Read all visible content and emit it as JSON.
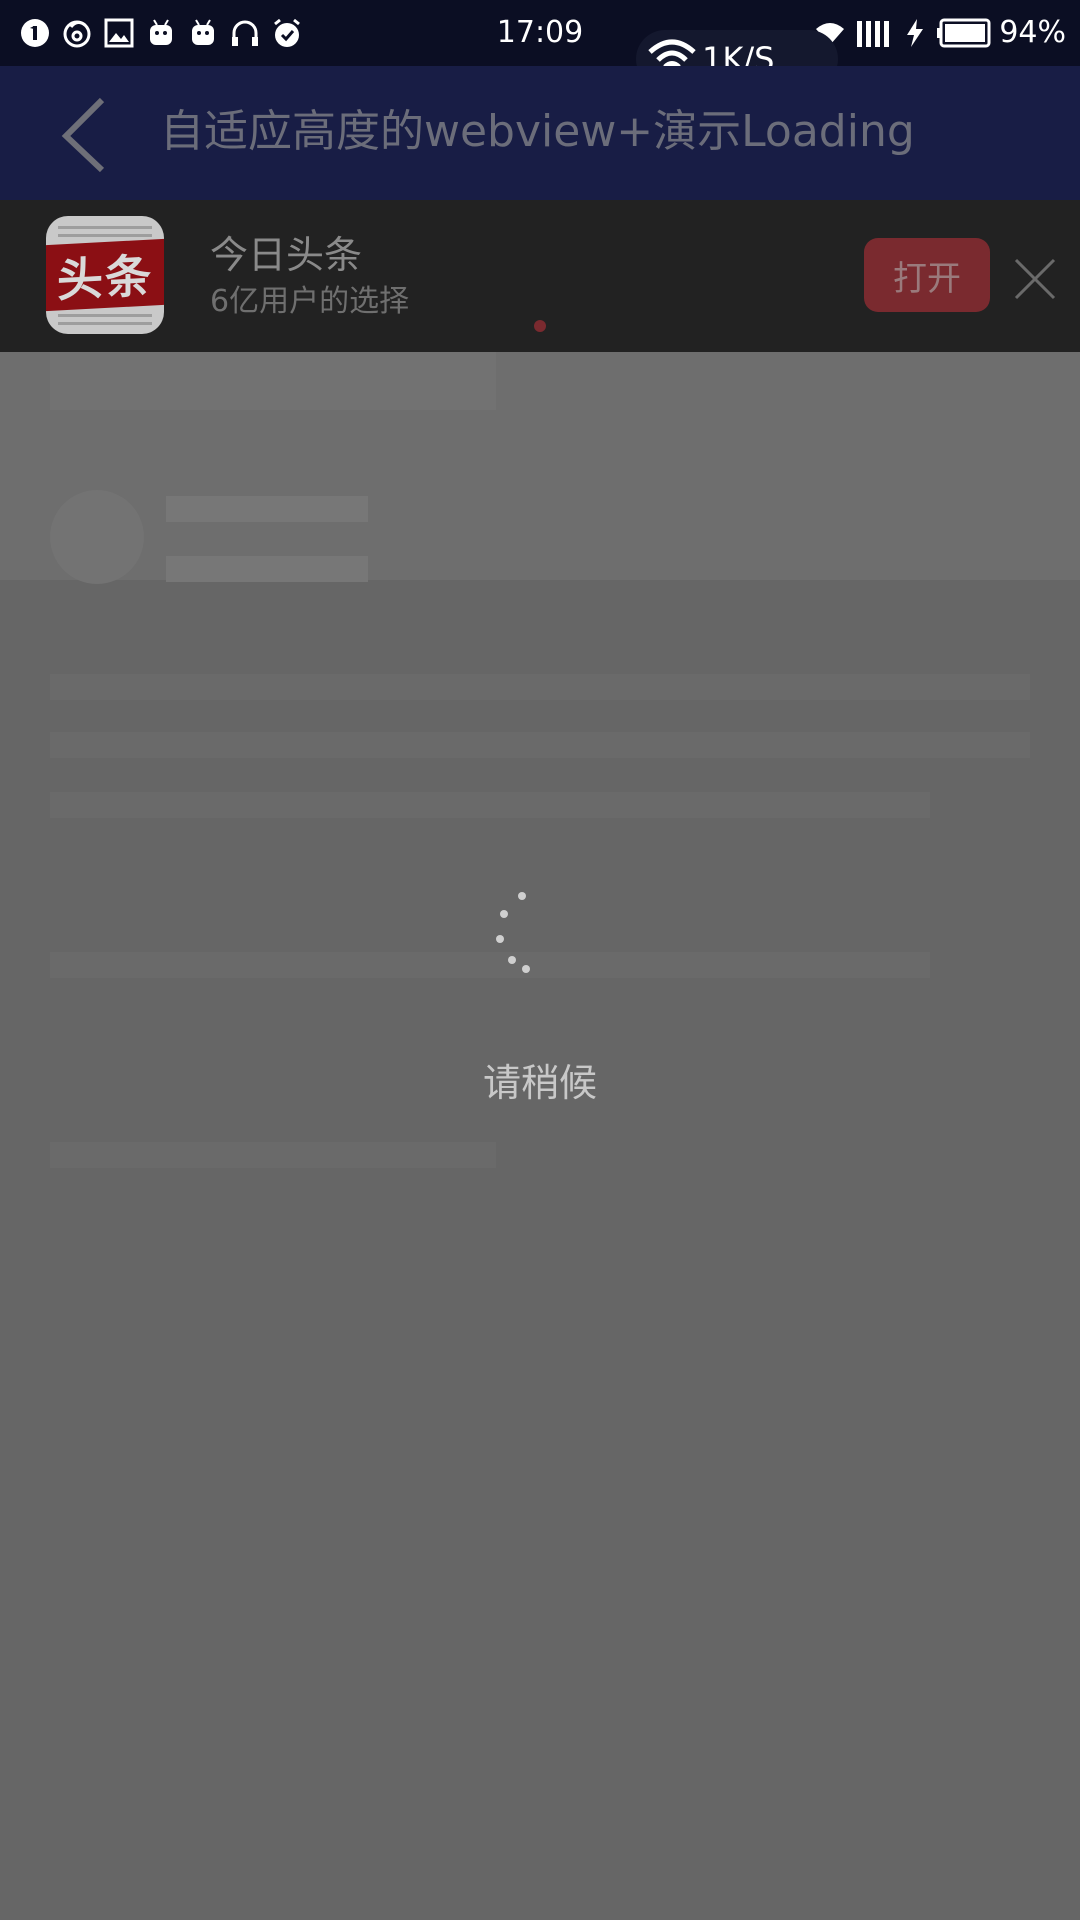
{
  "status_bar": {
    "time": "17:09",
    "battery": "94%",
    "left_icons": [
      "notification-one-icon",
      "weibo-icon",
      "image-icon",
      "android-icon",
      "android-icon",
      "headphones-icon",
      "alarm-icon"
    ],
    "right_icons": [
      "wifi-icon",
      "signal-icon",
      "charging-icon",
      "battery-icon"
    ]
  },
  "speed_pill": {
    "text": "1K/S"
  },
  "header": {
    "title": "自适应高度的webview+演示Loading"
  },
  "banner": {
    "app_name": "今日头条",
    "tagline": "6亿用户的选择",
    "icon_text": "头条",
    "open_label": "打开"
  },
  "loading": {
    "text": "请稍候"
  },
  "colors": {
    "status_bar_bg": "#0b0e23",
    "header_bg": "#181d45",
    "banner_bg": "#222222",
    "overlay_bg": "#666666",
    "open_button": "#7a2a2f"
  }
}
